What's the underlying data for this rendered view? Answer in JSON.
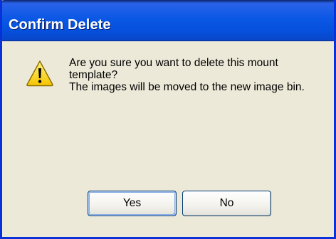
{
  "window": {
    "title": "Confirm Delete"
  },
  "dialog": {
    "icon": "warning-icon",
    "message_lines": [
      "Are you sure you want to delete this mount",
      "template?",
      "The images will be moved to the new image bin."
    ],
    "buttons": {
      "yes_label": "Yes",
      "no_label": "No"
    }
  },
  "colors": {
    "titlebar_blue": "#0A58E5",
    "frame_blue": "#0831D9",
    "dialog_bg": "#ECE9D8",
    "warning_yellow": "#FFD71A"
  }
}
